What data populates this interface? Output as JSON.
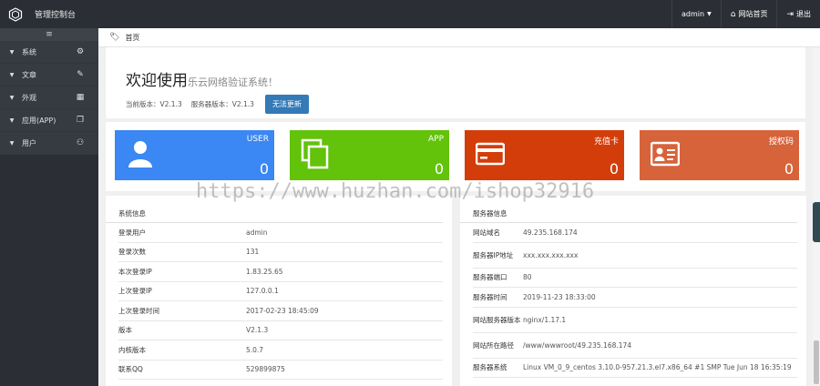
{
  "header": {
    "brand": "管理控制台",
    "user_menu": "admin",
    "site_home": "网站首页",
    "logout": "退出"
  },
  "sidebar": {
    "toggle": "≡",
    "items": [
      {
        "label": "系统",
        "icon": "gear-icon"
      },
      {
        "label": "文章",
        "icon": "edit-icon"
      },
      {
        "label": "外观",
        "icon": "grid-icon"
      },
      {
        "label": "应用(APP)",
        "icon": "copy-icon"
      },
      {
        "label": "用户",
        "icon": "users-icon"
      }
    ]
  },
  "breadcrumb": {
    "label": "首页"
  },
  "welcome": {
    "title": "欢迎使用",
    "subtitle": "乐云网络验证系统！",
    "current_version": "当前版本：V2.1.3",
    "server_version": "服务器版本：V2.1.3",
    "update_button": "无法更新"
  },
  "cards": [
    {
      "name": "USER",
      "value": "0",
      "color": "#3b87f3",
      "icon": "user-icon"
    },
    {
      "name": "APP",
      "value": "0",
      "color": "#63c20a",
      "icon": "copy-icon"
    },
    {
      "name": "充值卡",
      "value": "0",
      "color": "#d33d0a",
      "icon": "credit-card-icon"
    },
    {
      "name": "授权码",
      "value": "0",
      "color": "#d7633b",
      "icon": "id-card-icon"
    }
  ],
  "system_info": {
    "title": "系统信息",
    "rows": [
      {
        "k": "登录用户",
        "v": "admin"
      },
      {
        "k": "登录次数",
        "v": "131"
      },
      {
        "k": "本次登录IP",
        "v": "1.83.25.65"
      },
      {
        "k": "上次登录IP",
        "v": "127.0.0.1"
      },
      {
        "k": "上次登录时间",
        "v": "2017-02-23 18:45:09"
      },
      {
        "k": "版本",
        "v": "V2.1.3"
      },
      {
        "k": "内核版本",
        "v": "5.0.7"
      },
      {
        "k": "联系QQ",
        "v": "529899875"
      }
    ]
  },
  "server_info": {
    "title": "服务器信息",
    "rows": [
      {
        "k": "网站域名",
        "v": "49.235.168.174"
      },
      {
        "k": "服务器IP地址",
        "v": "xxx.xxx.xxx.xxx"
      },
      {
        "k": "服务器端口",
        "v": "80"
      },
      {
        "k": "服务器时间",
        "v": "2019-11-23 18:33:00"
      },
      {
        "k": "网站服务器版本",
        "v": "nginx/1.17.1"
      },
      {
        "k": "网站所在路径",
        "v": "/www/wwwroot/49.235.168.174"
      },
      {
        "k": "服务器系统",
        "v": "Linux VM_0_9_centos 3.10.0-957.21.3.el7.x86_64 #1 SMP Tue Jun 18 16:35:19"
      }
    ]
  },
  "watermark": "https://www.huzhan.com/ishop32916"
}
